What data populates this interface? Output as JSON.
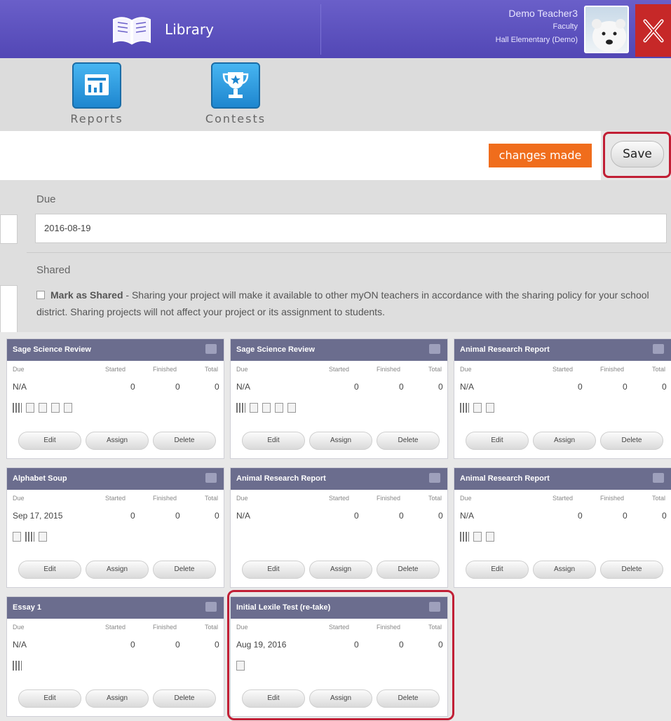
{
  "header": {
    "title": "Library",
    "user_name": "Demo Teacher3",
    "user_role": "Faculty",
    "user_school": "Hall Elementary (Demo)",
    "colors": {
      "header_bg": "#5c52bf",
      "close_bg": "#c62828"
    }
  },
  "toolbar": {
    "items": [
      {
        "label": "Reports",
        "icon": "reports-icon"
      },
      {
        "label": "Contests",
        "icon": "trophy-icon"
      }
    ]
  },
  "savebar": {
    "status": "changes made",
    "save_label": "Save",
    "status_color": "#f06d1c"
  },
  "form": {
    "due_label": "Due",
    "due_value": "2016-08-19",
    "shared_label": "Shared",
    "mark_shared_label": "Mark as Shared",
    "shared_description": " - Sharing your project will make it available to other myON teachers in accordance with the sharing policy for your school district. Sharing projects will not affect your project or its assignment to students."
  },
  "columns": {
    "due": "Due",
    "started": "Started",
    "finished": "Finished",
    "total": "Total"
  },
  "buttons": {
    "edit": "Edit",
    "assign": "Assign",
    "delete": "Delete"
  },
  "projects": [
    {
      "title": "Sage Science Review",
      "due": "N/A",
      "started": "0",
      "finished": "0",
      "total": "0",
      "icons": [
        "bar",
        "doc",
        "edit",
        "edit",
        "doc"
      ]
    },
    {
      "title": "Sage Science Review",
      "due": "N/A",
      "started": "0",
      "finished": "0",
      "total": "0",
      "icons": [
        "bar",
        "doc",
        "edit",
        "edit",
        "doc"
      ]
    },
    {
      "title": "Animal Research Report",
      "due": "N/A",
      "started": "0",
      "finished": "0",
      "total": "0",
      "icons": [
        "bar",
        "edit",
        "doc"
      ]
    },
    {
      "title": "Alphabet Soup",
      "due": "Sep 17, 2015",
      "started": "0",
      "finished": "0",
      "total": "0",
      "icons": [
        "edit",
        "bar",
        "edit"
      ]
    },
    {
      "title": "Animal Research Report",
      "due": "N/A",
      "started": "0",
      "finished": "0",
      "total": "0",
      "icons": []
    },
    {
      "title": "Animal Research Report",
      "due": "N/A",
      "started": "0",
      "finished": "0",
      "total": "0",
      "icons": [
        "bar",
        "edit",
        "doc"
      ]
    },
    {
      "title": "Essay 1",
      "due": "N/A",
      "started": "0",
      "finished": "0",
      "total": "0",
      "icons": [
        "bar"
      ]
    },
    {
      "title": "Initial Lexile Test (re-take)",
      "due": "Aug 19, 2016",
      "started": "0",
      "finished": "0",
      "total": "0",
      "icons": [
        "doc"
      ]
    }
  ]
}
